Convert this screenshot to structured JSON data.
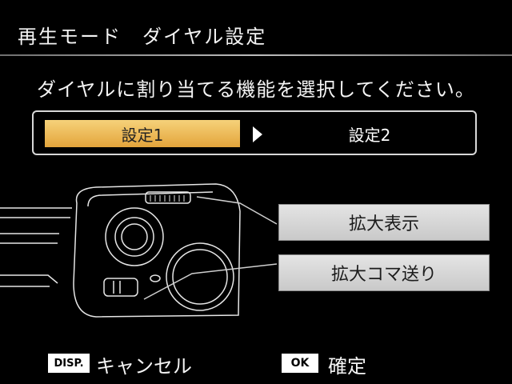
{
  "header": {
    "title": "再生モード　ダイヤル設定"
  },
  "instruction": "ダイヤルに割り当てる機能を選択してください。",
  "settings": {
    "option1": "設定1",
    "option2": "設定2",
    "selected": "設定1"
  },
  "functions": [
    {
      "label": "拡大表示"
    },
    {
      "label": "拡大コマ送り"
    }
  ],
  "footer": {
    "disp_key": "DISP.",
    "cancel_label": "キャンセル",
    "ok_key": "OK",
    "confirm_label": "確定"
  },
  "colors": {
    "background": "#000000",
    "highlight": "#e8b04a",
    "button_bg": "#d6d6d6"
  },
  "icons": [
    "camera-illustration",
    "right-arrow-icon"
  ]
}
